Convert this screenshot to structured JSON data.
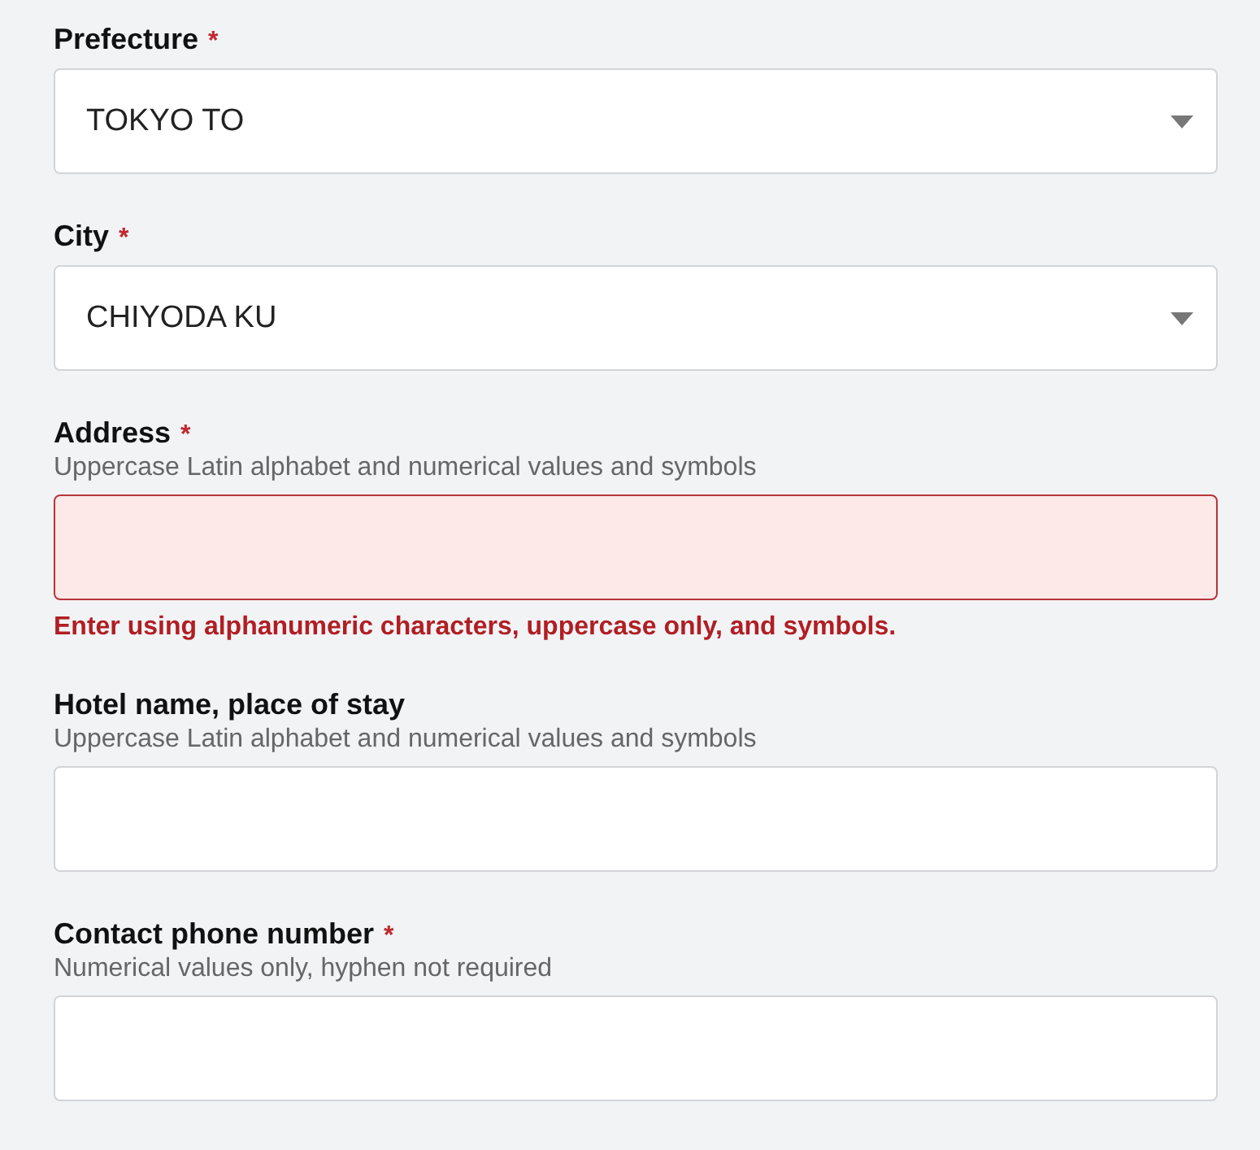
{
  "fields": [
    {
      "kind": "select",
      "label": "Prefecture",
      "required_mark": "*",
      "value": "TOKYO TO",
      "invalid": false
    },
    {
      "kind": "select",
      "label": "City",
      "required_mark": "*",
      "value": "CHIYODA KU",
      "invalid": false
    },
    {
      "kind": "text",
      "label": "Address",
      "required_mark": "*",
      "hint": "Uppercase Latin alphabet and numerical values and symbols",
      "invalid": true,
      "error": "Enter using alphanumeric characters, uppercase only, and symbols."
    },
    {
      "kind": "text",
      "label": "Hotel name, place of stay",
      "hint": "Uppercase Latin alphabet and numerical values and symbols",
      "invalid": false
    },
    {
      "kind": "text",
      "label": "Contact phone number",
      "required_mark": "*",
      "hint": "Numerical values only, hyphen not required",
      "invalid": false
    }
  ]
}
